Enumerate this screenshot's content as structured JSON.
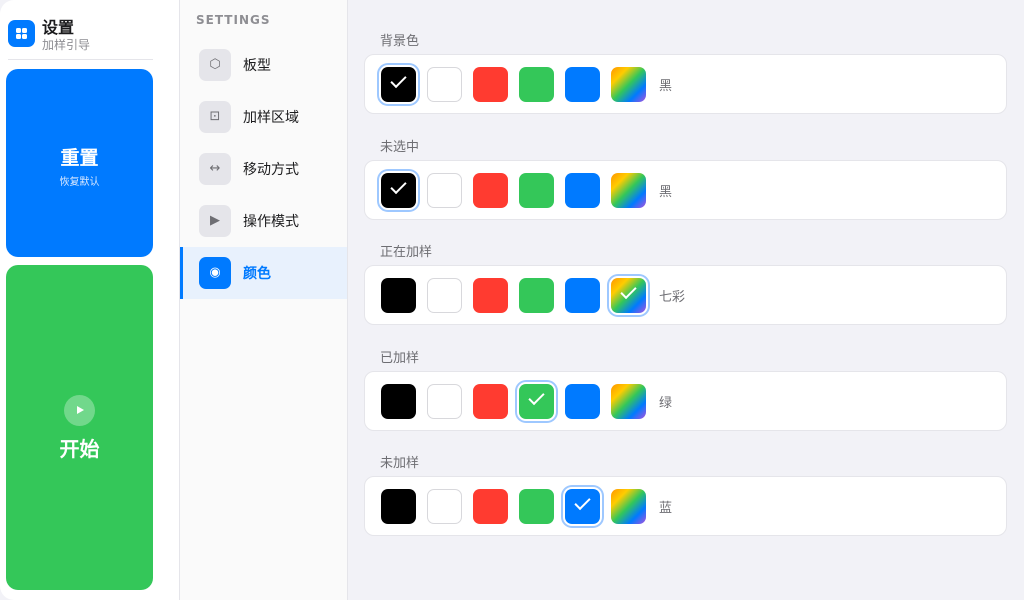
{
  "app": {
    "title": "设置",
    "subtitle": "加样引导"
  },
  "actions": {
    "reset": {
      "label": "重置",
      "sub": "恢复默认"
    },
    "start": {
      "label": "开始"
    }
  },
  "menu": {
    "heading": "SETTINGS",
    "items": [
      {
        "label": "板型",
        "icon": "hexagon-icon",
        "glyph": "⬡",
        "active": false
      },
      {
        "label": "加样区域",
        "icon": "square-dot-icon",
        "glyph": "⊡",
        "active": false
      },
      {
        "label": "移动方式",
        "icon": "arrows-horizontal-icon",
        "glyph": "↔",
        "active": false
      },
      {
        "label": "操作模式",
        "icon": "play-icon",
        "glyph": "▶",
        "active": false
      },
      {
        "label": "颜色",
        "icon": "radio-target-icon",
        "glyph": "◉",
        "active": true
      }
    ]
  },
  "palette": [
    {
      "key": "black",
      "color": "#000000"
    },
    {
      "key": "white",
      "color": "#ffffff"
    },
    {
      "key": "red",
      "color": "#ff3b30"
    },
    {
      "key": "green",
      "color": "#34c759"
    },
    {
      "key": "blue",
      "color": "#007aff"
    },
    {
      "key": "rainbow",
      "color": "linear-gradient(135deg, #ff9500 0%, #ffcc00 25%, #34c759 50%, #007aff 75%, #af52de 100%)"
    }
  ],
  "sections": [
    {
      "label": "背景色",
      "selected": 0,
      "value": "黑"
    },
    {
      "label": "未选中",
      "selected": 0,
      "value": "黑"
    },
    {
      "label": "正在加样",
      "selected": 5,
      "value": "七彩"
    },
    {
      "label": "已加样",
      "selected": 3,
      "value": "绿"
    },
    {
      "label": "未加样",
      "selected": 4,
      "value": "蓝"
    }
  ]
}
